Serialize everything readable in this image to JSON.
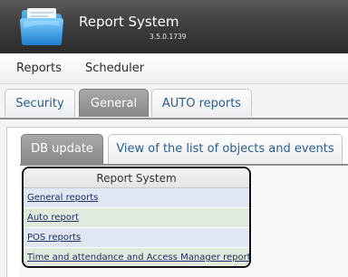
{
  "app": {
    "title": "Report System",
    "version": "3.5.0.1739",
    "icon": "folder-icon"
  },
  "menu": {
    "items": [
      {
        "label": "Reports"
      },
      {
        "label": "Scheduler"
      }
    ]
  },
  "tabs": {
    "items": [
      {
        "label": "Security",
        "active": false
      },
      {
        "label": "General",
        "active": true
      },
      {
        "label": "AUTO reports",
        "active": false
      }
    ]
  },
  "subtabs": {
    "items": [
      {
        "label": "DB update",
        "active": true
      },
      {
        "label": "View of the list of objects and events",
        "active": false
      }
    ]
  },
  "report_system": {
    "header": "Report System",
    "items": [
      {
        "label": "General reports",
        "color": "#dfe7f2"
      },
      {
        "label": "Auto report",
        "color": "#e1ebdd"
      },
      {
        "label": "POS reports",
        "color": "#dfe7f2"
      },
      {
        "label": "Time and attendance and Access Manager reports",
        "color": "#e1ebdd"
      }
    ]
  },
  "colors": {
    "header_bg": "#3f3f3f",
    "active_tab": "#8e8e8e",
    "tab_text": "#2a5f8c",
    "link": "#1f2c66"
  }
}
